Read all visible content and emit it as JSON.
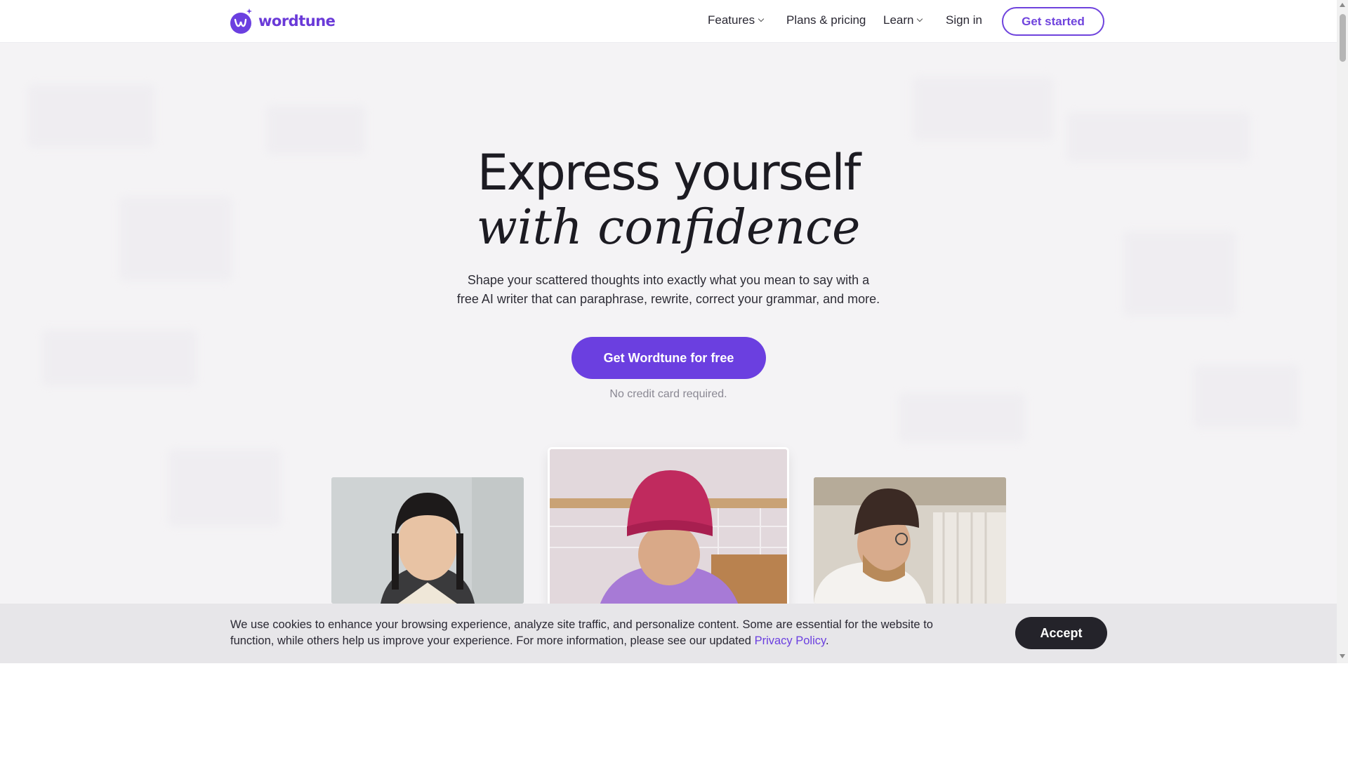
{
  "brand": {
    "name": "wordtune",
    "color": "#6b3fe0"
  },
  "nav": {
    "features": "Features",
    "plans": "Plans & pricing",
    "learn": "Learn",
    "sign_in": "Sign in",
    "get_started": "Get started"
  },
  "hero": {
    "title_line1": "Express yourself",
    "title_line2": "with confidence",
    "subtitle_line1": "Shape your scattered thoughts into exactly what you mean to say with a",
    "subtitle_line2": "free AI writer that can paraphrase, rewrite, correct your grammar, and more.",
    "cta": "Get Wordtune for free",
    "note": "No credit card required."
  },
  "cookie": {
    "text_before": "We use cookies to enhance your browsing experience, analyze site traffic, and personalize content. Some are essential for the website to function, while others help us improve your experience. For more information, please see our updated ",
    "link": "Privacy Policy",
    "text_after": ".",
    "accept": "Accept"
  },
  "icons": {
    "logo": "wordtune-logo-icon",
    "features_dropdown": "chevron-down-icon",
    "learn_dropdown": "chevron-down-icon"
  }
}
